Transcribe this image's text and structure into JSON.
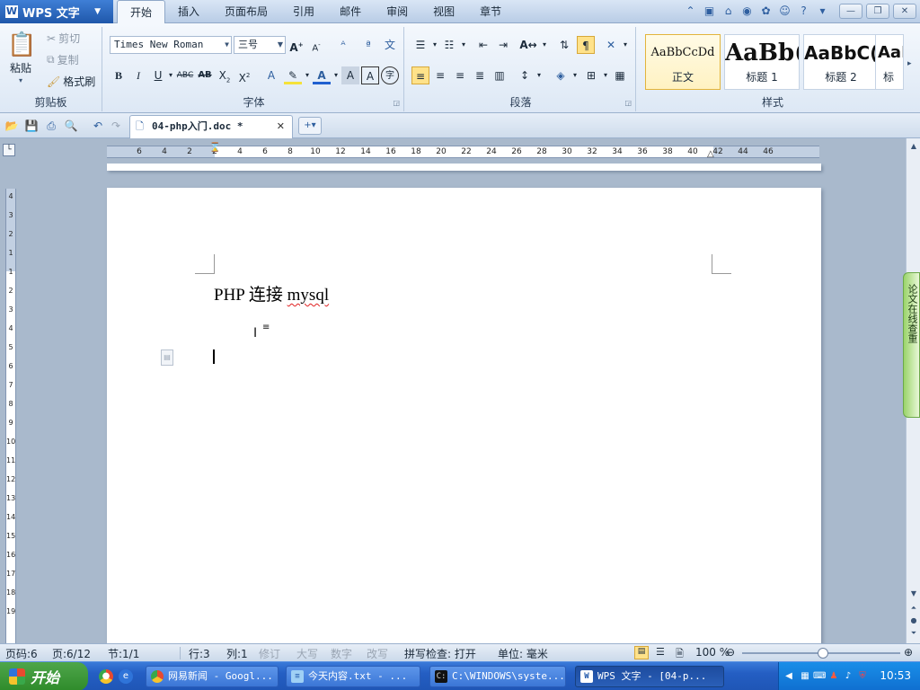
{
  "app": {
    "name": "WPS 文字",
    "menu_arrow": "▼",
    "tabs": [
      "开始",
      "插入",
      "页面布局",
      "引用",
      "邮件",
      "审阅",
      "视图",
      "章节"
    ],
    "active_tab": "开始"
  },
  "ribbon": {
    "clipboard": {
      "label": "剪贴板",
      "paste": "粘贴",
      "cut": "剪切",
      "copy": "复制",
      "format_painter": "格式刷"
    },
    "font": {
      "label": "字体",
      "family": "Times New Roman",
      "size": "三号"
    },
    "paragraph": {
      "label": "段落"
    },
    "styles": {
      "label": "样式",
      "items": [
        {
          "preview": "AaBbCcDd",
          "name": "正文"
        },
        {
          "preview": "AaBb(",
          "name": "标题 1"
        },
        {
          "preview": "AaBbC(",
          "name": "标题 2"
        },
        {
          "preview": "AaI",
          "name": "标"
        }
      ]
    }
  },
  "document": {
    "tab_title": "04-php入门.doc *",
    "heading_prefix": "PHP 连接 ",
    "heading_misspelled": "mysql"
  },
  "ruler": {
    "h_numbers": [
      "6",
      "4",
      "2",
      "2",
      "4",
      "6",
      "8",
      "10",
      "12",
      "14",
      "16",
      "18",
      "20",
      "22",
      "24",
      "26",
      "28",
      "30",
      "32",
      "34",
      "36",
      "38",
      "40",
      "42",
      "44",
      "46"
    ],
    "v_numbers": [
      "4",
      "3",
      "2",
      "1",
      "1",
      "2",
      "3",
      "4",
      "5",
      "6",
      "7",
      "8",
      "9",
      "10",
      "11",
      "12",
      "13",
      "14",
      "15",
      "16",
      "17",
      "18",
      "19"
    ]
  },
  "side_tab": "论文在线查重",
  "status": {
    "page_num": "页码:6",
    "page": "页:6/12",
    "section": "节:1/1",
    "row": "行:3",
    "col": "列:1",
    "revise": "修订",
    "caps": "大写",
    "num": "数字",
    "overwrite": "改写",
    "spell": "拼写检查: 打开",
    "unit": "单位: 毫米",
    "zoom": "100 %"
  },
  "taskbar": {
    "start": "开始",
    "tasks": [
      {
        "label": "网易新闻 - Googl...",
        "icon": "chrome-icon"
      },
      {
        "label": "今天内容.txt - ...",
        "icon": "notepad-icon"
      },
      {
        "label": "C:\\WINDOWS\\syste...",
        "icon": "cmd-icon"
      },
      {
        "label": "WPS 文字 - [04-p...",
        "icon": "wps-icon"
      }
    ],
    "time": "10:53"
  },
  "colors": {
    "accent": "#1f57aa",
    "spell_error": "#e02020",
    "highlight": "#ffe28a"
  }
}
